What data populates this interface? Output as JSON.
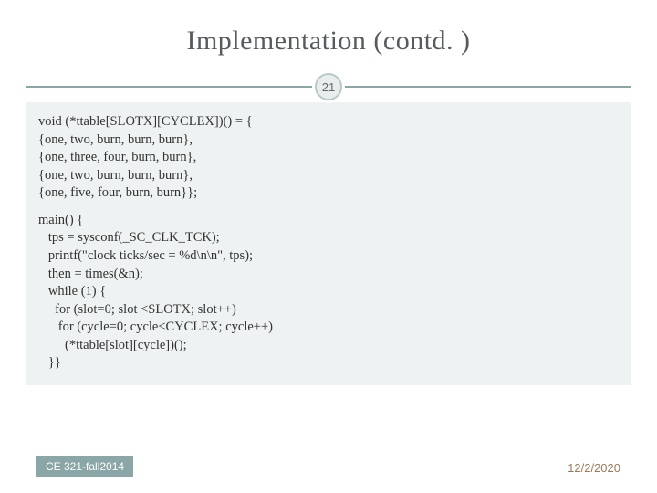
{
  "title": "Implementation (contd. )",
  "pageNumber": "21",
  "code1": "void (*ttable[SLOTX][CYCLEX])() = {\n{one, two, burn, burn, burn},\n{one, three, four, burn, burn},\n{one, two, burn, burn, burn},\n{one, five, four, burn, burn}};",
  "code2": "main() {\n   tps = sysconf(_SC_CLK_TCK);\n   printf(\"clock ticks/sec = %d\\n\\n\", tps);\n   then = times(&n);\n   while (1) {\n     for (slot=0; slot <SLOTX; slot++)\n      for (cycle=0; cycle<CYCLEX; cycle++)\n        (*ttable[slot][cycle])();\n   }}",
  "footerLeft": "CE 321-fall2014",
  "footerRight": "12/2/2020"
}
